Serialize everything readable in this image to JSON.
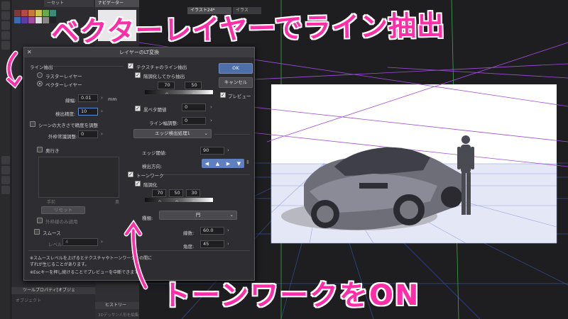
{
  "overlay": {
    "headline": "ベクターレイヤーでライン抽出",
    "footer": "トーンワークをON"
  },
  "panels": {
    "tab_preset": "ーセット",
    "tab_navigator": "ナビゲーター",
    "tab_tool_property": "ツールプロパティ[オブジェ",
    "tool_property_sub": "オブジェクト",
    "tab_history": "ヒストリー",
    "history_item": "3Dデッサン人形を編集"
  },
  "document_tabs": [
    "イラスト24*",
    "イラス"
  ],
  "dialog": {
    "title": "レイヤーのLT変換",
    "ok_label": "OK",
    "cancel_label": "キャンセル",
    "preview_label": "プレビュー",
    "line_extract": {
      "header": "ライン抽出",
      "raster_label": "ラスターレイヤー",
      "vector_label": "ベクターレイヤー",
      "line_width_label": "線幅:",
      "line_width_value": "0.01",
      "line_width_unit": "mm",
      "detect_precision_label": "検出精度:",
      "detect_precision_value": "10",
      "scene_scale_label": "シーンの大きさで精度を調整",
      "outer_edge_label": "外枠常識調整:",
      "outer_edge_value": "0",
      "depth_label": "奥行き",
      "depth_near": "手前",
      "depth_far": "奥",
      "reset_label": "リセット",
      "outer_only_label": "外枠線のみ適用",
      "smooth_label": "スムース",
      "level_label": "レベル",
      "level_value": "4"
    },
    "texture": {
      "texture_line_label": "テクスチャのライン抽出",
      "posterize_label": "階調化してから抽出",
      "slider_values": [
        "70",
        "50"
      ],
      "black_threshold_label": "黒ベタ閾値",
      "black_threshold_value": "0",
      "line_width_adjust_label": "ライン幅調整:",
      "line_width_adjust_value": "0",
      "edge_detect_button": "エッジ検出処理1",
      "edge_threshold_label": "エッジ閾値:",
      "edge_threshold_value": "90",
      "detect_direction_label": "検出方向:"
    },
    "tonework": {
      "tonework_label": "トーンワーク",
      "posterize_label": "階調化",
      "slider_values": [
        "70",
        "50",
        "30"
      ],
      "type_label": "種類:",
      "type_value": "円",
      "lines_label": "線数:",
      "lines_value": "60.0",
      "angle_label": "角度:",
      "angle_value": "45"
    },
    "notes": [
      "※スムースレベルを上げるとテクスチャやトーンワークとの間に",
      "ずれが生じることがあります。",
      "※Escキーを押し続けることでプレビューを中断できます。"
    ]
  },
  "colors": {
    "overlay_text": "#ff2ea8",
    "perspective_lines": "#8a2be2",
    "ground_lines": "#4a6fd0",
    "ok_button": "#4f6fa8"
  }
}
